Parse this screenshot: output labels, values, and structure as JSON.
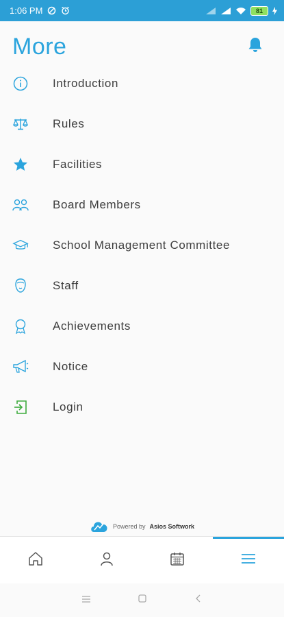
{
  "status_bar": {
    "time": "1:06 PM",
    "battery": "81"
  },
  "header": {
    "title": "More"
  },
  "menu": [
    {
      "label": "Introduction",
      "icon": "info-icon"
    },
    {
      "label": "Rules",
      "icon": "scale-icon"
    },
    {
      "label": "Facilities",
      "icon": "star-icon"
    },
    {
      "label": "Board Members",
      "icon": "people-icon"
    },
    {
      "label": "School Management Committee",
      "icon": "graduation-cap-icon"
    },
    {
      "label": "Staff",
      "icon": "face-icon"
    },
    {
      "label": "Achievements",
      "icon": "award-icon"
    },
    {
      "label": "Notice",
      "icon": "megaphone-icon"
    },
    {
      "label": "Login",
      "icon": "login-icon"
    }
  ],
  "footer": {
    "powered_by": "Powered by",
    "company": "Asios Softwork"
  },
  "bottom_nav": [
    {
      "name": "home",
      "icon": "home-icon",
      "active": false
    },
    {
      "name": "profile",
      "icon": "person-icon",
      "active": false
    },
    {
      "name": "calendar",
      "icon": "calendar-icon",
      "active": false
    },
    {
      "name": "more",
      "icon": "menu-icon",
      "active": true
    }
  ],
  "colors": {
    "accent": "#2ba4dd",
    "status_bar": "#2c9fd6",
    "login_icon": "#3cab3c"
  }
}
